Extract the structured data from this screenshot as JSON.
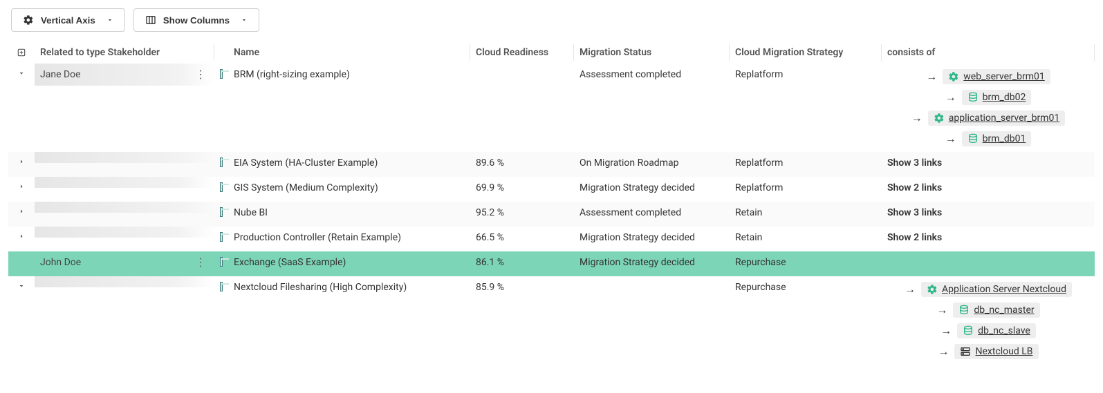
{
  "toolbar": {
    "vertical_axis_label": "Vertical Axis",
    "show_columns_label": "Show Columns"
  },
  "columns": {
    "stakeholder": "Related to type Stakeholder",
    "name": "Name",
    "cloud_readiness": "Cloud Readiness",
    "migration_status": "Migration Status",
    "strategy": "Cloud Migration Strategy",
    "consists_of": "consists of"
  },
  "groups": [
    {
      "stakeholder": "Jane Doe",
      "rows": [
        {
          "name": "BRM (right-sizing example)",
          "cloud_readiness": "",
          "migration_status": "Assessment completed",
          "strategy": "Replatform",
          "links": [
            {
              "icon": "gear-green",
              "label": "web_server_brm01"
            },
            {
              "icon": "db",
              "label": "brm_db02"
            },
            {
              "icon": "gear-green",
              "label": "application_server_brm01"
            },
            {
              "icon": "db",
              "label": "brm_db01"
            }
          ]
        },
        {
          "name": "EIA System (HA-Cluster Example)",
          "cloud_readiness": "89.6 %",
          "migration_status": "On Migration Roadmap",
          "strategy": "Replatform",
          "links_summary": "Show 3 links"
        },
        {
          "name": "GIS System (Medium Complexity)",
          "cloud_readiness": "69.9 %",
          "migration_status": "Migration Strategy decided",
          "strategy": "Replatform",
          "links_summary": "Show 2 links"
        },
        {
          "name": "Nube BI",
          "cloud_readiness": "95.2 %",
          "migration_status": "Assessment completed",
          "strategy": "Retain",
          "links_summary": "Show 3 links"
        },
        {
          "name": "Production Controller (Retain Example)",
          "cloud_readiness": "66.5 %",
          "migration_status": "Migration Strategy decided",
          "strategy": "Retain",
          "links_summary": "Show 2 links"
        }
      ]
    },
    {
      "stakeholder": "John Doe",
      "rows": [
        {
          "name": "Exchange (SaaS Example)",
          "cloud_readiness": "86.1 %",
          "migration_status": "Migration Strategy decided",
          "strategy": "Repurchase",
          "links_summary": "",
          "highlight": true
        },
        {
          "name": "Nextcloud Filesharing (High Complexity)",
          "cloud_readiness": "85.9 %",
          "migration_status": "",
          "strategy": "Repurchase",
          "links": [
            {
              "icon": "gear-green",
              "label": "Application Server Nextcloud"
            },
            {
              "icon": "db",
              "label": "db_nc_master"
            },
            {
              "icon": "db",
              "label": "db_nc_slave"
            },
            {
              "icon": "server",
              "label": "Nextcloud LB"
            }
          ]
        }
      ]
    }
  ]
}
